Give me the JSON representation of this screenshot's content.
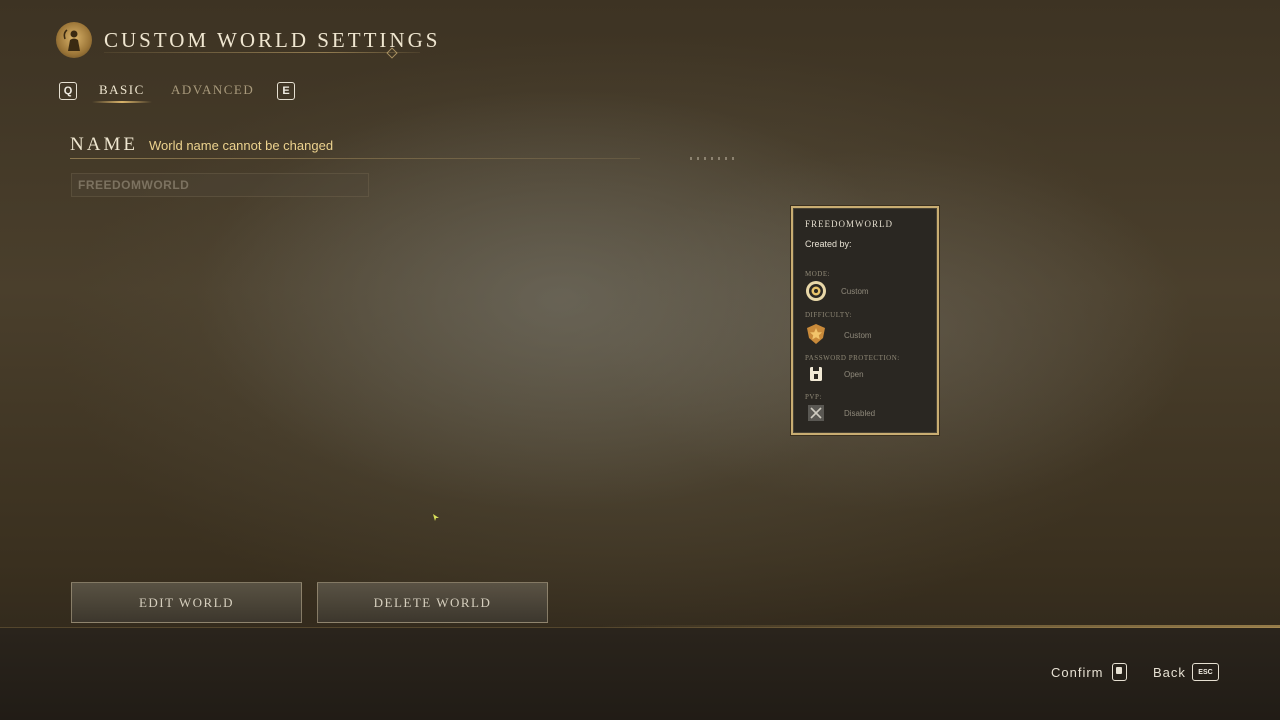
{
  "header": {
    "title": "CUSTOM WORLD SETTINGS"
  },
  "tabs": {
    "prev_key": "Q",
    "next_key": "E",
    "items": [
      {
        "label": "BASIC",
        "active": true
      },
      {
        "label": "ADVANCED",
        "active": false
      }
    ]
  },
  "name_section": {
    "heading": "NAME",
    "note": "World name cannot be changed",
    "input_value": "FREEDOMWORLD"
  },
  "world_card": {
    "title": "FREEDOMWORLD",
    "creator_label": "Created by:",
    "rows": [
      {
        "label": "MODE:",
        "value": "Custom",
        "icon": "gear-icon"
      },
      {
        "label": "DIFFICULTY:",
        "value": "Custom",
        "icon": "star-shield-icon"
      },
      {
        "label": "PASSWORD PROTECTION:",
        "value": "Open",
        "icon": "unlocked-icon"
      },
      {
        "label": "PVP:",
        "value": "Disabled",
        "icon": "crossed-swords-icon"
      }
    ]
  },
  "buttons": {
    "edit": "EDIT WORLD",
    "delete": "DELETE WORLD"
  },
  "footer": {
    "confirm_label": "Confirm",
    "confirm_icon": "mouse-left-click-icon",
    "back_label": "Back",
    "back_key": "ESC"
  },
  "colors": {
    "accent_gold": "#d9b36a",
    "note_text": "#ecd28e",
    "card_border": "#c9ad72"
  }
}
